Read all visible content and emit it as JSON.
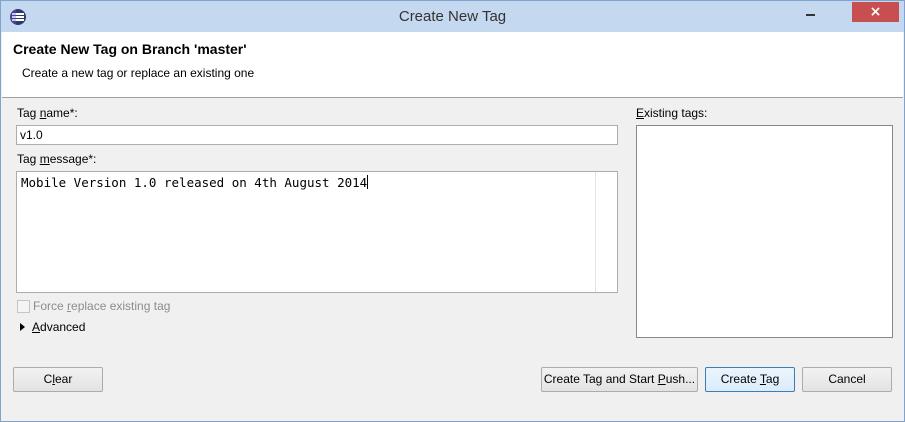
{
  "window": {
    "title": "Create New Tag",
    "close_glyph": "×",
    "icons": {
      "app": "eclipse-icon",
      "minimize": "minimize-icon",
      "close": "close-icon"
    }
  },
  "header": {
    "title": "Create New Tag on Branch 'master'",
    "description": "Create a new tag or replace an existing one"
  },
  "form": {
    "tag_name_label_pre": "Tag ",
    "tag_name_label_key": "n",
    "tag_name_label_post": "ame*:",
    "tag_name_value": "v1.0",
    "tag_message_label_pre": "Tag ",
    "tag_message_label_key": "m",
    "tag_message_label_post": "essage*:",
    "tag_message_value": "Mobile Version 1.0 released on 4th August 2014",
    "force_replace_pre": "Force ",
    "force_replace_key": "r",
    "force_replace_post": "eplace existing tag",
    "force_replace_checked": false,
    "advanced_key": "A",
    "advanced_post": "dvanced",
    "existing_tags_label_key": "E",
    "existing_tags_label_post": "xisting tags:",
    "existing_tags": []
  },
  "buttons": {
    "clear_pre": "C",
    "clear_key": "l",
    "clear_post": "ear",
    "create_push_pre": "Create Tag and Start ",
    "create_push_key": "P",
    "create_push_post": "ush...",
    "create_tag_pre": "Create ",
    "create_tag_key": "T",
    "create_tag_post": "ag",
    "cancel": "Cancel"
  }
}
